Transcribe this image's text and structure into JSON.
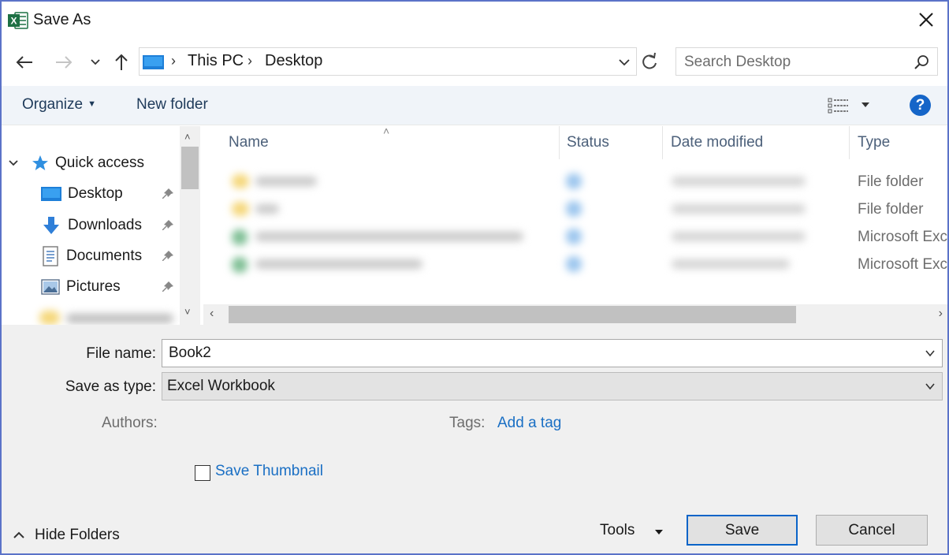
{
  "window": {
    "title": "Save As"
  },
  "address": {
    "crumbs": [
      "This PC",
      "Desktop"
    ]
  },
  "search": {
    "placeholder": "Search Desktop"
  },
  "toolbar": {
    "organize": "Organize",
    "new_folder": "New folder",
    "help": "?"
  },
  "nav": {
    "quick_access": "Quick access",
    "items": [
      {
        "label": "Desktop",
        "icon": "desktop-icon",
        "pinned": true
      },
      {
        "label": "Downloads",
        "icon": "download-icon",
        "pinned": true
      },
      {
        "label": "Documents",
        "icon": "documents-icon",
        "pinned": true
      },
      {
        "label": "Pictures",
        "icon": "pictures-icon",
        "pinned": true
      }
    ]
  },
  "filelist": {
    "columns": [
      "Name",
      "Status",
      "Date modified",
      "Type"
    ],
    "rows": [
      {
        "type": "File folder",
        "icon": "folder-icon"
      },
      {
        "type": "File folder",
        "icon": "folder-icon"
      },
      {
        "type": "Microsoft Excel",
        "icon": "excel-file-icon"
      },
      {
        "type": "Microsoft Excel",
        "icon": "excel-file-icon"
      }
    ]
  },
  "form": {
    "file_name_label": "File name:",
    "file_name_value": "Book2",
    "save_as_type_label": "Save as type:",
    "save_as_type_value": "Excel Workbook",
    "authors_label": "Authors:",
    "tags_label": "Tags:",
    "add_tag": "Add a tag",
    "save_thumbnail": "Save Thumbnail",
    "save_thumbnail_checked": false
  },
  "footer": {
    "hide_folders": "Hide Folders",
    "tools": "Tools",
    "save": "Save",
    "cancel": "Cancel"
  },
  "colors": {
    "accent": "#1565c8",
    "link": "#1a6fc4",
    "border": "#5b73c8",
    "excel_green": "#1d7044"
  }
}
